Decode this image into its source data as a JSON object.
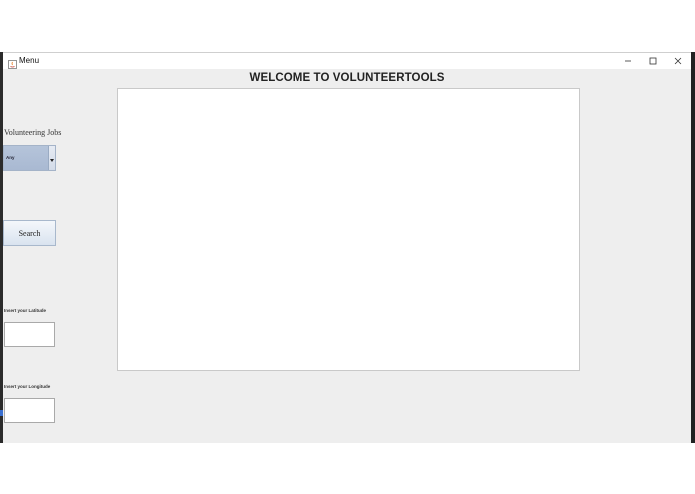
{
  "window": {
    "title": "Menu",
    "app_icon": "java-app-icon"
  },
  "controls": {
    "minimize": "minimize-icon",
    "maximize": "maximize-icon",
    "close": "close-icon"
  },
  "heading": "WELCOME TO VOLUNTEERTOOLS",
  "sidebar": {
    "jobs_label": "Volunteering Jobs",
    "jobs_select_value": "Any",
    "search_label": "Search",
    "latitude_label": "Insert your Latitude",
    "latitude_value": "",
    "longitude_label": "Insert your Longitude",
    "longitude_value": ""
  },
  "colors": {
    "window_bg": "#eeeeee",
    "combo_bg": "#b5c4da",
    "button_bg": "#d9e3ef"
  }
}
